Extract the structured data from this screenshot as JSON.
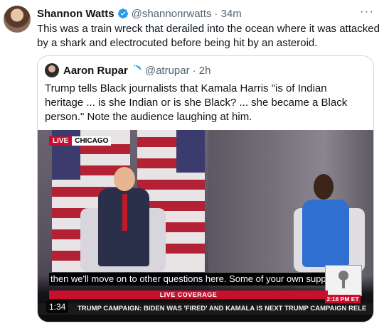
{
  "tweet": {
    "author_name": "Shannon Watts",
    "handle": "@shannonrwatts",
    "time": "· 34m",
    "more": "···",
    "text": "This was a train wreck that derailed into the ocean where it was attacked by a shark and electrocuted before being hit by an asteroid."
  },
  "quoted": {
    "author_name": "Aaron Rupar",
    "handle": "@atrupar",
    "time": "· 2h",
    "text": "Trump tells Black journalists that Kamala Harris \"is of Indian heritage ... is she Indian or is she Black? ... she became a Black person.\" Note the audience laughing at him."
  },
  "video": {
    "live_label": "LIVE",
    "location": "CHICAGO",
    "caption": "then we'll move on to other questions here. Some of your own supporters,",
    "coverage": "LIVE COVERAGE",
    "ticker": "TRUMP CAMPAIGN: BIDEN WAS 'FIRED' AND KAMALA IS NEXT    TRUMP CAMPAIGN RELE",
    "clock": "2:18 PM ET",
    "duration": "1:34"
  },
  "colors": {
    "verified": "#1d9bf0",
    "live_red": "#c8102e"
  }
}
